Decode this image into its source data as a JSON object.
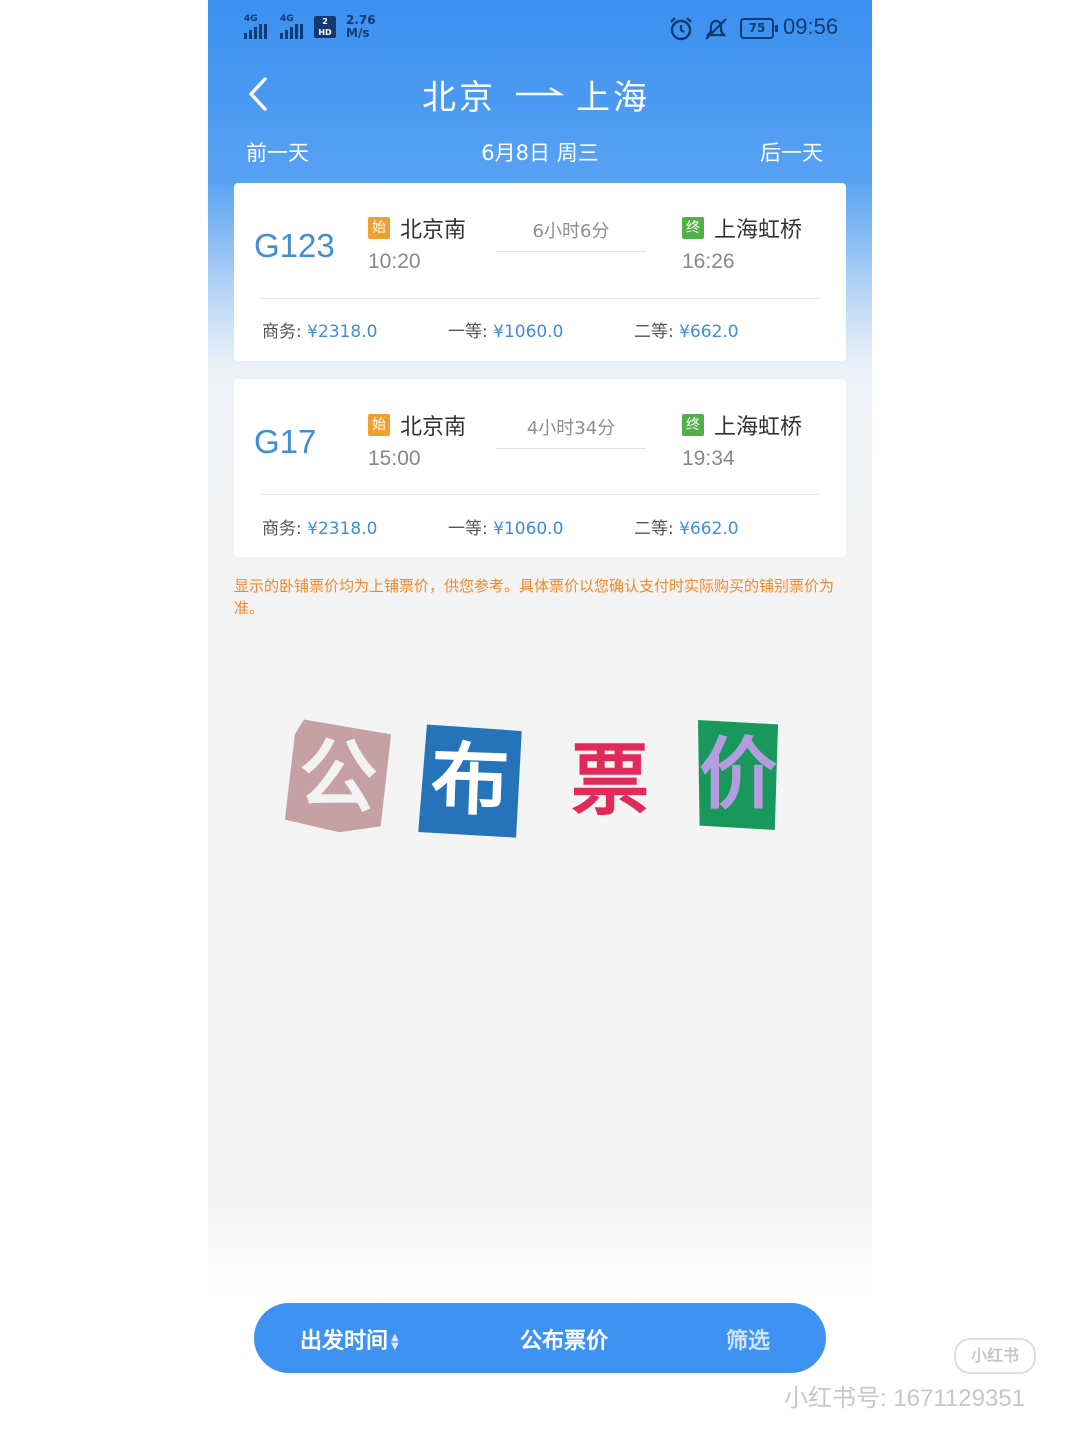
{
  "status_bar": {
    "net1": "4G",
    "net2": "4G",
    "hd_top": "2",
    "hd": "HD",
    "speed": "2.76",
    "speed_unit": "M/s",
    "battery": "75",
    "time": "09:56"
  },
  "header": {
    "from": "北京",
    "to": "上海",
    "prev_day": "前一天",
    "date": "6月8日 周三",
    "next_day": "后一天"
  },
  "trains": [
    {
      "no": "G123",
      "start_badge": "始",
      "from_station": "北京南",
      "depart": "10:20",
      "duration": "6小时6分",
      "end_badge": "终",
      "to_station": "上海虹桥",
      "arrive": "16:26",
      "prices": [
        {
          "label": "商务:",
          "value": "¥2318.0"
        },
        {
          "label": "一等:",
          "value": "¥1060.0"
        },
        {
          "label": "二等:",
          "value": "¥662.0"
        }
      ]
    },
    {
      "no": "G17",
      "start_badge": "始",
      "from_station": "北京南",
      "depart": "15:00",
      "duration": "4小时34分",
      "end_badge": "终",
      "to_station": "上海虹桥",
      "arrive": "19:34",
      "prices": [
        {
          "label": "商务:",
          "value": "¥2318.0"
        },
        {
          "label": "一等:",
          "value": "¥1060.0"
        },
        {
          "label": "二等:",
          "value": "¥662.0"
        }
      ]
    }
  ],
  "notice": "显示的卧铺票价均为上铺票价，供您参考。具体票价以您确认支付时实际购买的铺别票价为准。",
  "overlay_chars": [
    "公",
    "布",
    "票",
    "价"
  ],
  "bottom_bar": {
    "depart_time": "出发时间",
    "publish_price": "公布票价",
    "filter": "筛选"
  },
  "watermark": {
    "logo": "小红书",
    "text": "小红书号: 1671129351"
  },
  "colors": {
    "header_blue": "#3a90f0",
    "price_blue": "#3f8ed6",
    "notice_orange": "#f08a2a",
    "start_badge": "#f0a030",
    "end_badge": "#52b04a"
  }
}
